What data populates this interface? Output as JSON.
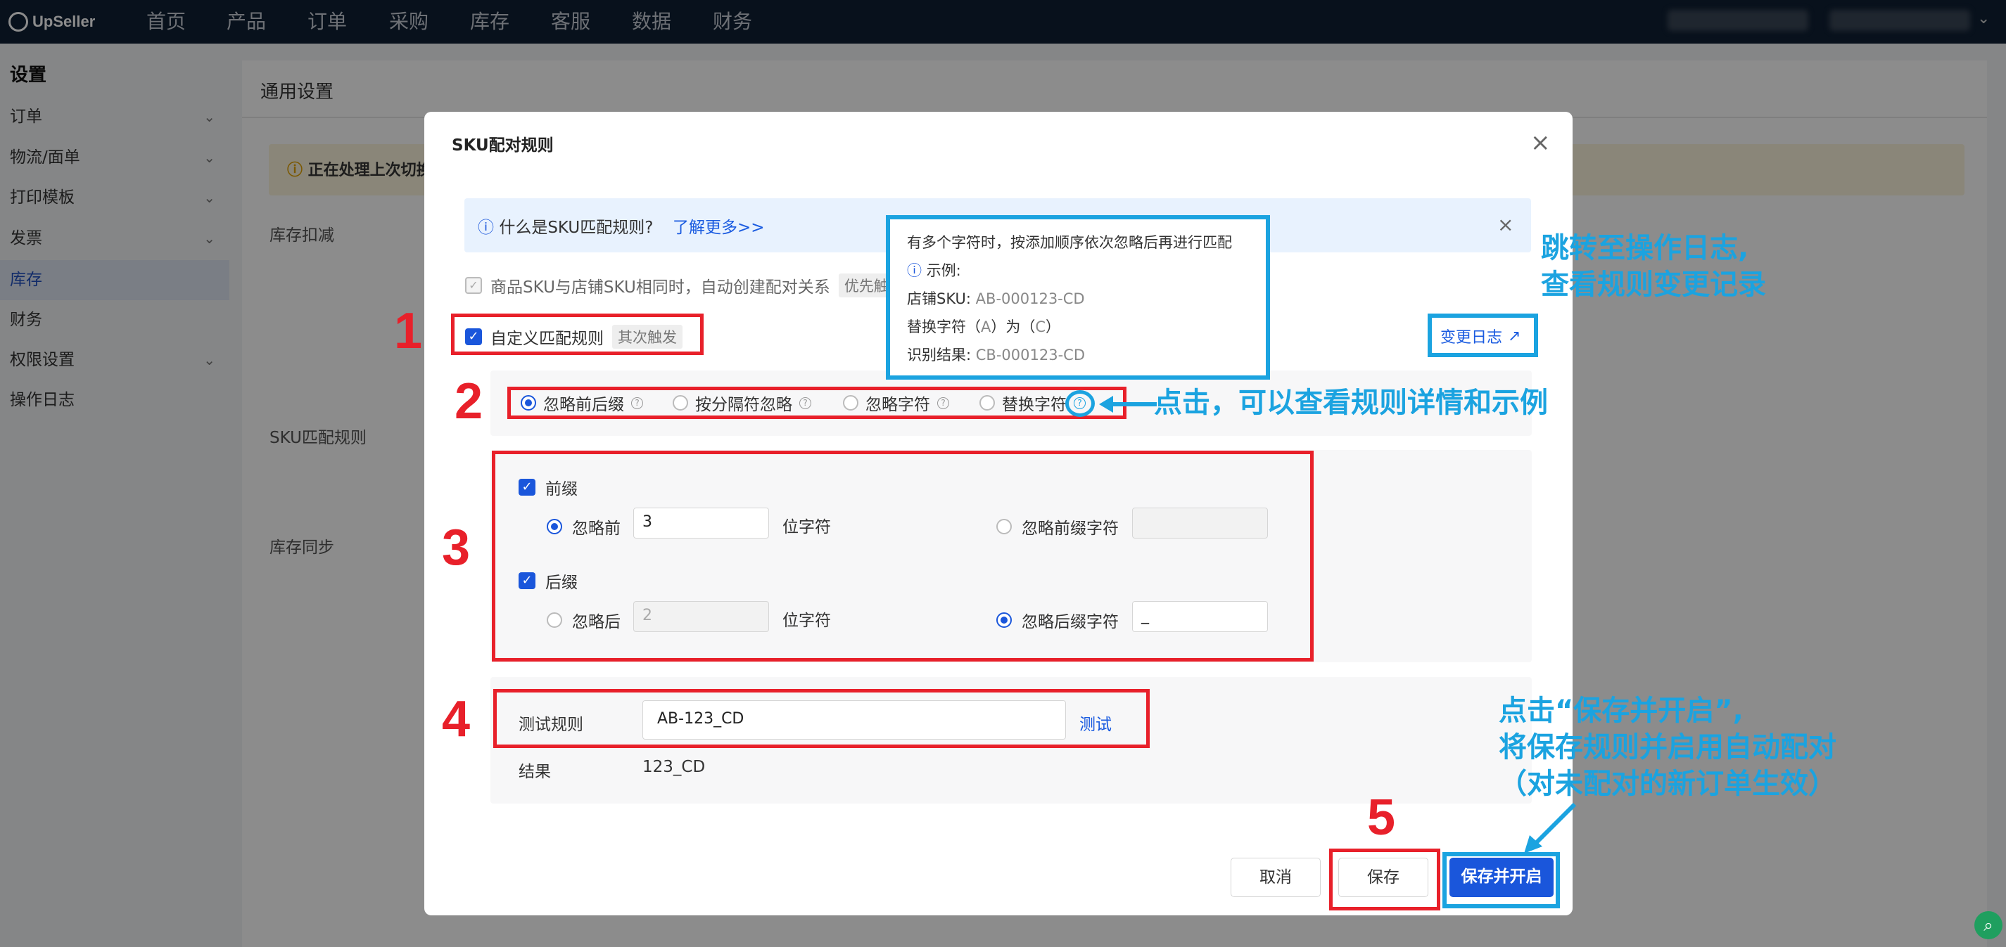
{
  "topnav": {
    "brand": "UpSeller",
    "items": [
      "首页",
      "产品",
      "订单",
      "采购",
      "库存",
      "客服",
      "数据",
      "财务"
    ]
  },
  "sidebar": {
    "title": "设置",
    "items": [
      {
        "label": "订单",
        "expandable": true
      },
      {
        "label": "物流/面单",
        "expandable": true
      },
      {
        "label": "打印模板",
        "expandable": true
      },
      {
        "label": "发票",
        "expandable": true
      },
      {
        "label": "库存",
        "expandable": false,
        "active": true
      },
      {
        "label": "财务",
        "expandable": false
      },
      {
        "label": "权限设置",
        "expandable": true
      },
      {
        "label": "操作日志",
        "expandable": false
      }
    ]
  },
  "background": {
    "page_title": "通用设置",
    "warning": "正在处理上次切换",
    "labels": [
      "库存扣减",
      "SKU匹配规则",
      "库存同步"
    ]
  },
  "modal": {
    "title": "SKU配对规则",
    "info": {
      "text": "什么是SKU匹配规则?",
      "link": "了解更多>>"
    },
    "auto_rule": {
      "label": "商品SKU与店铺SKU相同时，自动创建配对关系",
      "tag": "优先触发",
      "checked": true,
      "disabled": true
    },
    "custom_rule": {
      "label": "自定义匹配规则",
      "tag": "其次触发",
      "checked": true
    },
    "changelog_link": "变更日志",
    "rule_tabs": [
      {
        "label": "忽略前后缀",
        "selected": true
      },
      {
        "label": "按分隔符忽略",
        "selected": false
      },
      {
        "label": "忽略字符",
        "selected": false
      },
      {
        "label": "替换字符",
        "selected": false
      }
    ],
    "prefix": {
      "label": "前缀",
      "checked": true,
      "opt1_label": "忽略前",
      "opt1_selected": true,
      "opt1_value": "3",
      "unit": "位字符",
      "opt2_label": "忽略前缀字符",
      "opt2_selected": false,
      "opt2_value": ""
    },
    "suffix": {
      "label": "后缀",
      "checked": true,
      "opt1_label": "忽略后",
      "opt1_selected": false,
      "opt1_value": "2",
      "unit": "位字符",
      "opt2_label": "忽略后缀字符",
      "opt2_selected": true,
      "opt2_value": "_"
    },
    "test": {
      "label": "测试规则",
      "value": "AB-123_CD",
      "button": "测试",
      "result_label": "结果",
      "result_value": "123_CD"
    },
    "buttons": {
      "cancel": "取消",
      "save": "保存",
      "save_enable": "保存并开启"
    }
  },
  "tooltip": {
    "line1": "有多个字符时，按添加顺序依次忽略后再进行匹配",
    "line2": "示例:",
    "line3_label": "店铺SKU:",
    "line3_value": "AB-000123-CD",
    "line4_a": "替换字符（",
    "line4_b": "A",
    "line4_c": "）为（",
    "line4_d": "C",
    "line4_e": "）",
    "line5_label": "识别结果:",
    "line5_value": "CB-000123-CD"
  },
  "annotations": {
    "num1": "1",
    "num2": "2",
    "num3": "3",
    "num4": "4",
    "num5": "5",
    "note_changelog_1": "跳转至操作日志,",
    "note_changelog_2": "查看规则变更记录",
    "note_help": "点击，可以查看规则详情和示例",
    "note_save_1": "点击“保存并开启”,",
    "note_save_2": "将保存规则并启用自动配对",
    "note_save_3": "（对未配对的新订单生效）"
  },
  "colors": {
    "accent": "#1a56db",
    "annotation_red": "#e8202a",
    "annotation_blue": "#1ba3e0",
    "nav_bg": "#0f1f33"
  }
}
